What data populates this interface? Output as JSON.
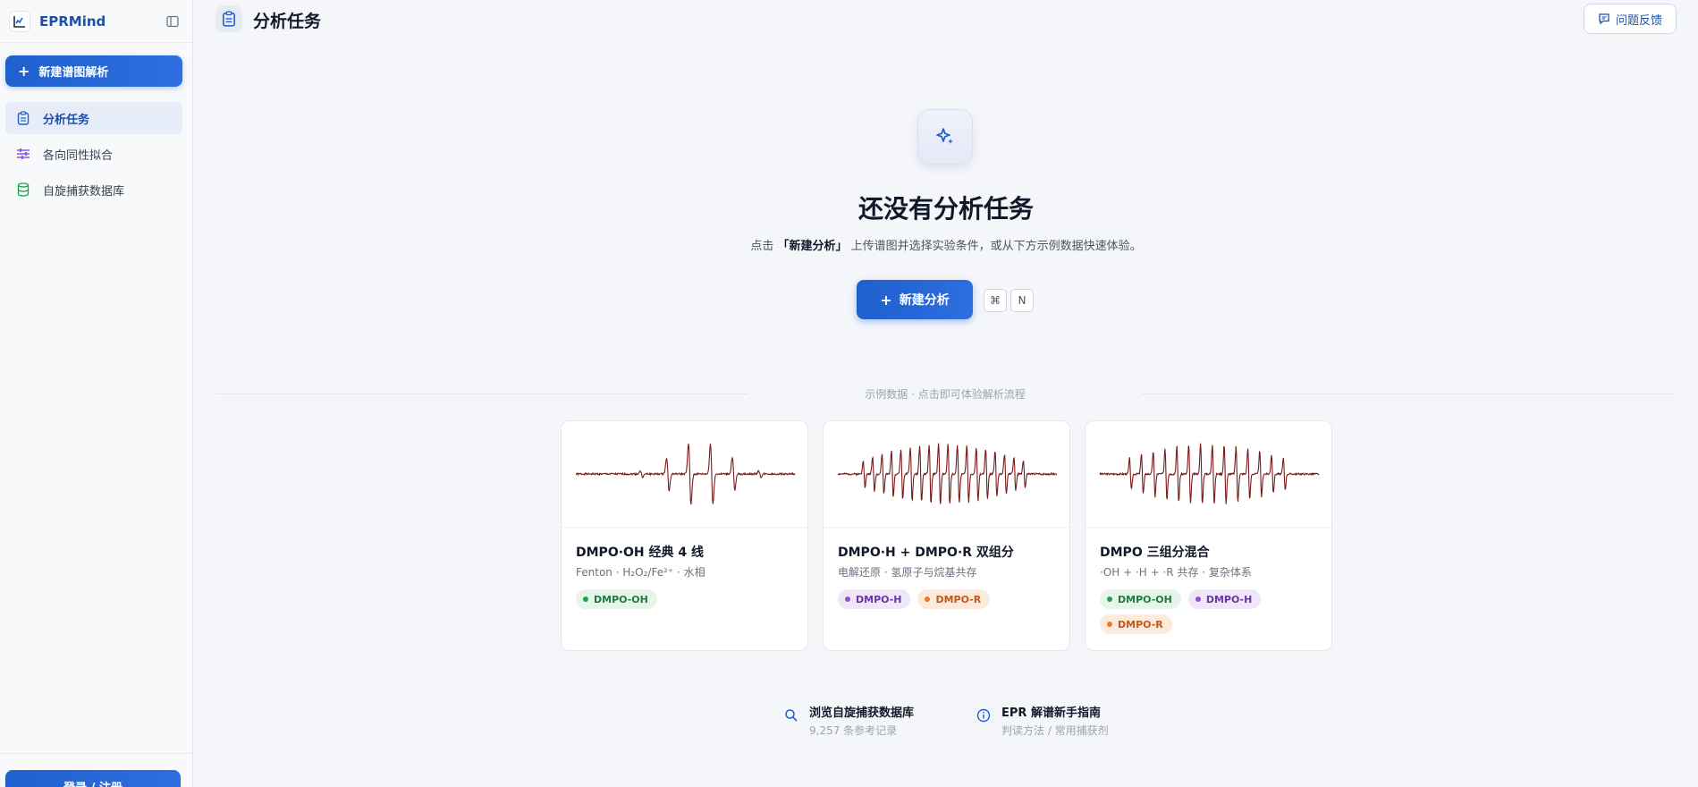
{
  "app": {
    "name": "EPRMind"
  },
  "sidebar": {
    "new_button": "新建谱图解析",
    "items": [
      {
        "label": "分析任务",
        "icon": "clipboard-icon",
        "active": true
      },
      {
        "label": "各向同性拟合",
        "icon": "sliders-icon",
        "active": false
      },
      {
        "label": "自旋捕获数据库",
        "icon": "database-icon",
        "active": false
      }
    ],
    "login_button": "登录 / 注册"
  },
  "header": {
    "title": "分析任务",
    "feedback_button": "问题反馈"
  },
  "empty_state": {
    "title": "还没有分析任务",
    "subtitle_prefix": "点击",
    "subtitle_highlight": "「新建分析」",
    "subtitle_suffix": "上传谱图并选择实验条件，或从下方示例数据快速体验。",
    "cta_label": "新建分析",
    "shortcut_keys": [
      "⌘",
      "N"
    ]
  },
  "examples": {
    "divider_label": "示例数据 · 点击即可体验解析流程",
    "cards": [
      {
        "title": "DMPO·OH 经典 4 线",
        "subtitle": "Fenton · H₂O₂/Fe²⁺ · 水相",
        "tags": [
          {
            "label": "DMPO-OH",
            "kind": "oh"
          }
        ]
      },
      {
        "title": "DMPO·H + DMPO·R 双组分",
        "subtitle": "电解还原 · 氢原子与烷基共存",
        "tags": [
          {
            "label": "DMPO-H",
            "kind": "h"
          },
          {
            "label": "DMPO-R",
            "kind": "r"
          }
        ]
      },
      {
        "title": "DMPO 三组分混合",
        "subtitle": "·OH + ·H + ·R 共存 · 复杂体系",
        "tags": [
          {
            "label": "DMPO-OH",
            "kind": "oh"
          },
          {
            "label": "DMPO-H",
            "kind": "h"
          },
          {
            "label": "DMPO-R",
            "kind": "r"
          }
        ]
      }
    ]
  },
  "links": [
    {
      "title": "浏览自旋捕获数据库",
      "subtitle": "9,257 条参考记录",
      "icon": "search-icon"
    },
    {
      "title": "EPR 解谱新手指南",
      "subtitle": "判读方法 / 常用捕获剂",
      "icon": "info-icon"
    }
  ],
  "colors": {
    "accent": "#1f5fce",
    "spectrum_line": "#7a1a1a"
  }
}
